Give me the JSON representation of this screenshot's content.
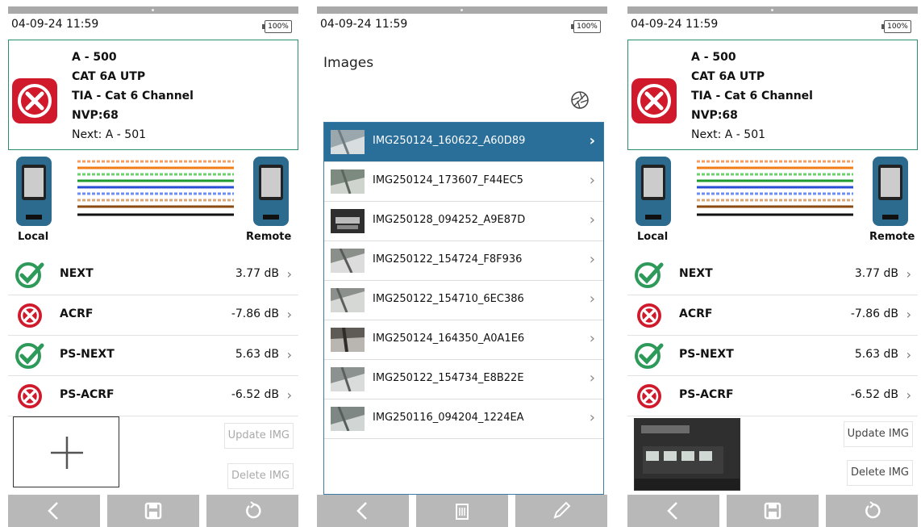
{
  "status": {
    "time": "04-09-24 11:59",
    "battery": "100%"
  },
  "colors": {
    "pass": "#2e9a5a",
    "fail": "#d01a2c",
    "select": "#2a6e9a",
    "bar": "#b8b8b8"
  },
  "link": {
    "id": "A - 500",
    "cable": "CAT 6A UTP",
    "standard": "TIA - Cat 6 Channel",
    "nvp": "NVP:68",
    "next_label": "Next: A - 501",
    "result_icon": "fail-x-icon"
  },
  "wiremap": {
    "local": "Local",
    "remote": "Remote",
    "pins": [
      "1",
      "2",
      "3",
      "6",
      "4",
      "5",
      "7",
      "8",
      "S"
    ]
  },
  "results": [
    {
      "name": "NEXT",
      "value": "3.77 dB",
      "status": "pass"
    },
    {
      "name": "ACRF",
      "value": "-7.86 dB",
      "status": "fail"
    },
    {
      "name": "PS-NEXT",
      "value": "5.63 dB",
      "status": "pass"
    },
    {
      "name": "PS-ACRF",
      "value": "-6.52 dB",
      "status": "fail"
    }
  ],
  "image_buttons": {
    "update": "Update IMG",
    "delete": "Delete IMG"
  },
  "toolbar1": [
    "back-icon",
    "save-icon",
    "retest-icon"
  ],
  "toolbar2": [
    "back-icon",
    "trash-icon",
    "pencil-icon"
  ],
  "images": {
    "title": "Images",
    "files": [
      "IMG250124_160622_A60D89",
      "IMG250124_173607_F44EC5",
      "IMG250128_094252_A9E87D",
      "IMG250122_154724_F8F936",
      "IMG250122_154710_6EC386",
      "IMG250124_164350_A0A1E6",
      "IMG250122_154734_E8B22E",
      "IMG250116_094204_1224EA"
    ]
  }
}
